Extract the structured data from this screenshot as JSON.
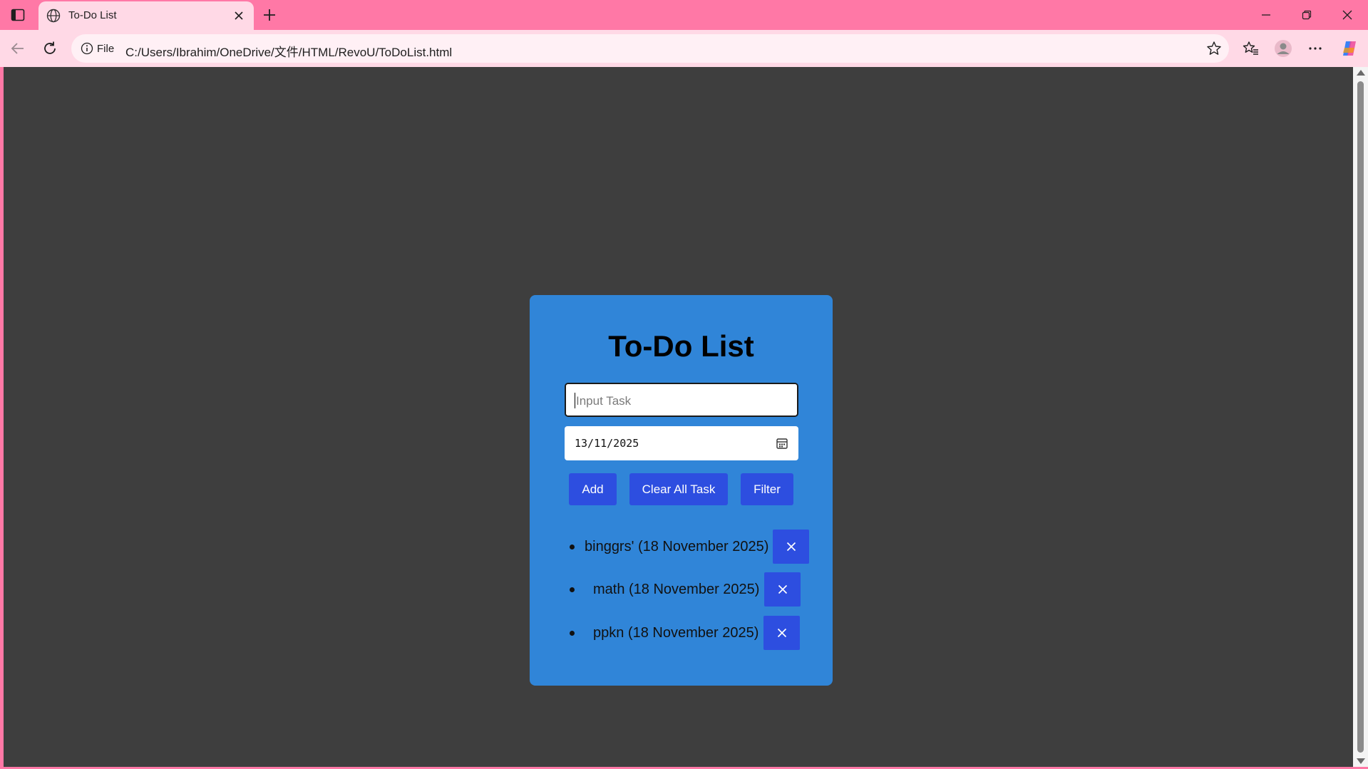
{
  "browser": {
    "tab_title": "To-Do List",
    "address_scheme": "File",
    "address_url": "C:/Users/Ibrahim/OneDrive/文件/HTML/RevoU/ToDoList.html",
    "accent": "#ff78a6"
  },
  "todo": {
    "title": "To-Do List",
    "task_placeholder": "Input Task",
    "date_value": "13/11/2025",
    "buttons": {
      "add": "Add",
      "clear": "Clear All Task",
      "filter": "Filter"
    },
    "tasks": [
      {
        "text": "binggrs' (18 November 2025)"
      },
      {
        "text": "math (18 November 2025)"
      },
      {
        "text": "ppkn (18 November 2025)"
      }
    ],
    "colors": {
      "page_bg": "#3e3e3e",
      "card_bg": "#3085d8",
      "button_bg": "#2d4ee0"
    }
  }
}
